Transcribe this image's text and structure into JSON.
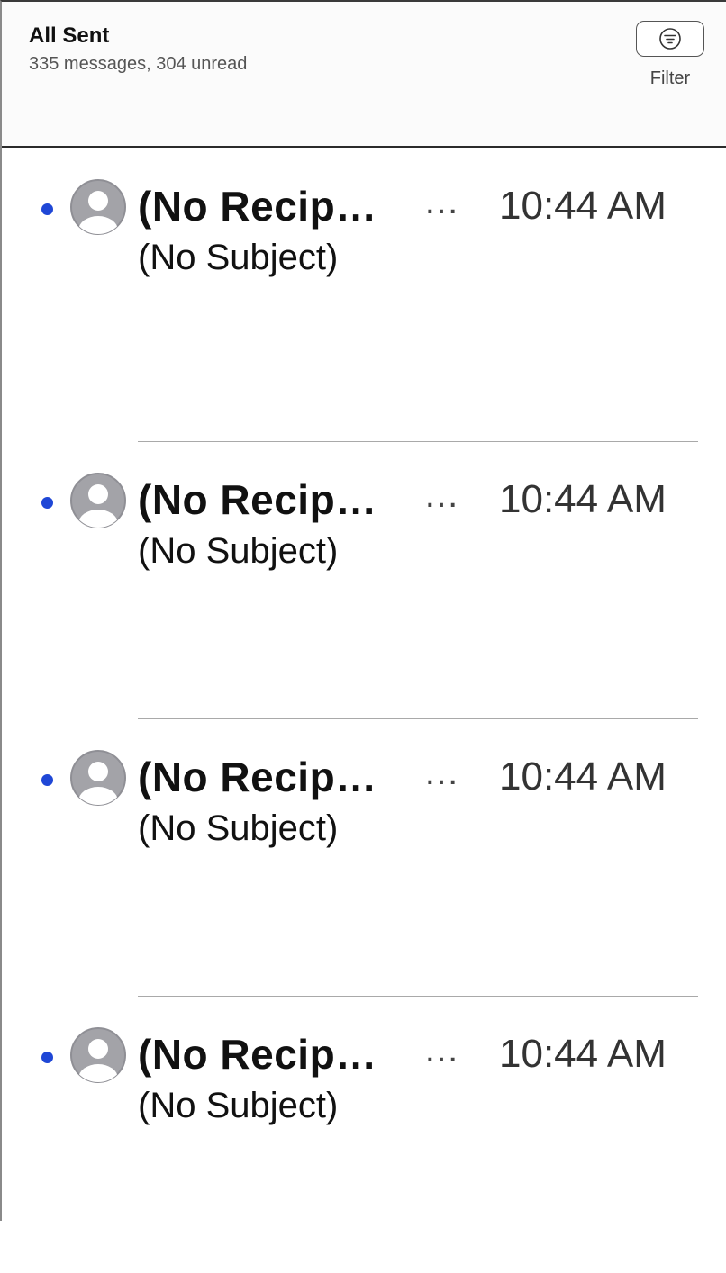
{
  "header": {
    "title": "All Sent",
    "subtitle": "335 messages, 304 unread",
    "filter_label": "Filter",
    "filter_icon": "filter-lines-circle-icon"
  },
  "colors": {
    "unread_dot": "#1f47d6",
    "avatar_bg": "#a3a3a8"
  },
  "messages": [
    {
      "sender": "(No Recip…",
      "more": "…",
      "time": "10:44 AM",
      "subject": "(No Subject)",
      "unread": true,
      "avatar_icon": "person-avatar-icon"
    },
    {
      "sender": "(No Recip…",
      "more": "…",
      "time": "10:44 AM",
      "subject": "(No Subject)",
      "unread": true,
      "avatar_icon": "person-avatar-icon"
    },
    {
      "sender": "(No Recip…",
      "more": "…",
      "time": "10:44 AM",
      "subject": "(No Subject)",
      "unread": true,
      "avatar_icon": "person-avatar-icon"
    },
    {
      "sender": "(No Recip…",
      "more": "…",
      "time": "10:44 AM",
      "subject": "(No Subject)",
      "unread": true,
      "avatar_icon": "person-avatar-icon"
    }
  ]
}
